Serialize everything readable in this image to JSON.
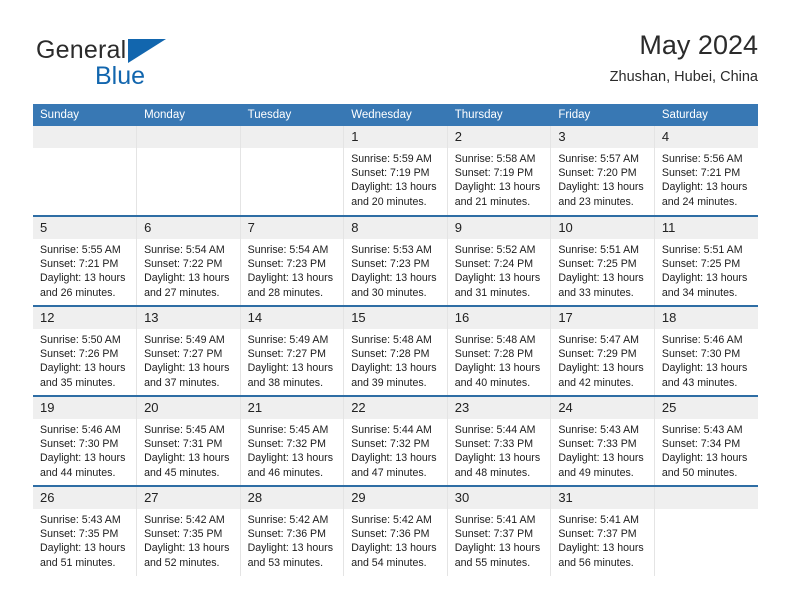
{
  "brand": {
    "name_part1": "General",
    "name_part2": "Blue",
    "logo_icon": "triangle-logo-icon"
  },
  "header": {
    "title": "May 2024",
    "location": "Zhushan, Hubei, China"
  },
  "calendar": {
    "accent_color": "#3878b4",
    "row_separator_color": "#2e6da4",
    "daynum_band_color": "#efefef",
    "weekday_headers": [
      "Sunday",
      "Monday",
      "Tuesday",
      "Wednesday",
      "Thursday",
      "Friday",
      "Saturday"
    ],
    "labels": {
      "sunrise": "Sunrise:",
      "sunset": "Sunset:",
      "daylight": "Daylight:"
    },
    "weeks": [
      [
        {
          "day": "",
          "blank": true
        },
        {
          "day": "",
          "blank": true
        },
        {
          "day": "",
          "blank": true
        },
        {
          "day": "1",
          "sunrise": "Sunrise: 5:59 AM",
          "sunset": "Sunset: 7:19 PM",
          "daylight_l1": "Daylight: 13 hours",
          "daylight_l2": "and 20 minutes."
        },
        {
          "day": "2",
          "sunrise": "Sunrise: 5:58 AM",
          "sunset": "Sunset: 7:19 PM",
          "daylight_l1": "Daylight: 13 hours",
          "daylight_l2": "and 21 minutes."
        },
        {
          "day": "3",
          "sunrise": "Sunrise: 5:57 AM",
          "sunset": "Sunset: 7:20 PM",
          "daylight_l1": "Daylight: 13 hours",
          "daylight_l2": "and 23 minutes."
        },
        {
          "day": "4",
          "sunrise": "Sunrise: 5:56 AM",
          "sunset": "Sunset: 7:21 PM",
          "daylight_l1": "Daylight: 13 hours",
          "daylight_l2": "and 24 minutes."
        }
      ],
      [
        {
          "day": "5",
          "sunrise": "Sunrise: 5:55 AM",
          "sunset": "Sunset: 7:21 PM",
          "daylight_l1": "Daylight: 13 hours",
          "daylight_l2": "and 26 minutes."
        },
        {
          "day": "6",
          "sunrise": "Sunrise: 5:54 AM",
          "sunset": "Sunset: 7:22 PM",
          "daylight_l1": "Daylight: 13 hours",
          "daylight_l2": "and 27 minutes."
        },
        {
          "day": "7",
          "sunrise": "Sunrise: 5:54 AM",
          "sunset": "Sunset: 7:23 PM",
          "daylight_l1": "Daylight: 13 hours",
          "daylight_l2": "and 28 minutes."
        },
        {
          "day": "8",
          "sunrise": "Sunrise: 5:53 AM",
          "sunset": "Sunset: 7:23 PM",
          "daylight_l1": "Daylight: 13 hours",
          "daylight_l2": "and 30 minutes."
        },
        {
          "day": "9",
          "sunrise": "Sunrise: 5:52 AM",
          "sunset": "Sunset: 7:24 PM",
          "daylight_l1": "Daylight: 13 hours",
          "daylight_l2": "and 31 minutes."
        },
        {
          "day": "10",
          "sunrise": "Sunrise: 5:51 AM",
          "sunset": "Sunset: 7:25 PM",
          "daylight_l1": "Daylight: 13 hours",
          "daylight_l2": "and 33 minutes."
        },
        {
          "day": "11",
          "sunrise": "Sunrise: 5:51 AM",
          "sunset": "Sunset: 7:25 PM",
          "daylight_l1": "Daylight: 13 hours",
          "daylight_l2": "and 34 minutes."
        }
      ],
      [
        {
          "day": "12",
          "sunrise": "Sunrise: 5:50 AM",
          "sunset": "Sunset: 7:26 PM",
          "daylight_l1": "Daylight: 13 hours",
          "daylight_l2": "and 35 minutes."
        },
        {
          "day": "13",
          "sunrise": "Sunrise: 5:49 AM",
          "sunset": "Sunset: 7:27 PM",
          "daylight_l1": "Daylight: 13 hours",
          "daylight_l2": "and 37 minutes."
        },
        {
          "day": "14",
          "sunrise": "Sunrise: 5:49 AM",
          "sunset": "Sunset: 7:27 PM",
          "daylight_l1": "Daylight: 13 hours",
          "daylight_l2": "and 38 minutes."
        },
        {
          "day": "15",
          "sunrise": "Sunrise: 5:48 AM",
          "sunset": "Sunset: 7:28 PM",
          "daylight_l1": "Daylight: 13 hours",
          "daylight_l2": "and 39 minutes."
        },
        {
          "day": "16",
          "sunrise": "Sunrise: 5:48 AM",
          "sunset": "Sunset: 7:28 PM",
          "daylight_l1": "Daylight: 13 hours",
          "daylight_l2": "and 40 minutes."
        },
        {
          "day": "17",
          "sunrise": "Sunrise: 5:47 AM",
          "sunset": "Sunset: 7:29 PM",
          "daylight_l1": "Daylight: 13 hours",
          "daylight_l2": "and 42 minutes."
        },
        {
          "day": "18",
          "sunrise": "Sunrise: 5:46 AM",
          "sunset": "Sunset: 7:30 PM",
          "daylight_l1": "Daylight: 13 hours",
          "daylight_l2": "and 43 minutes."
        }
      ],
      [
        {
          "day": "19",
          "sunrise": "Sunrise: 5:46 AM",
          "sunset": "Sunset: 7:30 PM",
          "daylight_l1": "Daylight: 13 hours",
          "daylight_l2": "and 44 minutes."
        },
        {
          "day": "20",
          "sunrise": "Sunrise: 5:45 AM",
          "sunset": "Sunset: 7:31 PM",
          "daylight_l1": "Daylight: 13 hours",
          "daylight_l2": "and 45 minutes."
        },
        {
          "day": "21",
          "sunrise": "Sunrise: 5:45 AM",
          "sunset": "Sunset: 7:32 PM",
          "daylight_l1": "Daylight: 13 hours",
          "daylight_l2": "and 46 minutes."
        },
        {
          "day": "22",
          "sunrise": "Sunrise: 5:44 AM",
          "sunset": "Sunset: 7:32 PM",
          "daylight_l1": "Daylight: 13 hours",
          "daylight_l2": "and 47 minutes."
        },
        {
          "day": "23",
          "sunrise": "Sunrise: 5:44 AM",
          "sunset": "Sunset: 7:33 PM",
          "daylight_l1": "Daylight: 13 hours",
          "daylight_l2": "and 48 minutes."
        },
        {
          "day": "24",
          "sunrise": "Sunrise: 5:43 AM",
          "sunset": "Sunset: 7:33 PM",
          "daylight_l1": "Daylight: 13 hours",
          "daylight_l2": "and 49 minutes."
        },
        {
          "day": "25",
          "sunrise": "Sunrise: 5:43 AM",
          "sunset": "Sunset: 7:34 PM",
          "daylight_l1": "Daylight: 13 hours",
          "daylight_l2": "and 50 minutes."
        }
      ],
      [
        {
          "day": "26",
          "sunrise": "Sunrise: 5:43 AM",
          "sunset": "Sunset: 7:35 PM",
          "daylight_l1": "Daylight: 13 hours",
          "daylight_l2": "and 51 minutes."
        },
        {
          "day": "27",
          "sunrise": "Sunrise: 5:42 AM",
          "sunset": "Sunset: 7:35 PM",
          "daylight_l1": "Daylight: 13 hours",
          "daylight_l2": "and 52 minutes."
        },
        {
          "day": "28",
          "sunrise": "Sunrise: 5:42 AM",
          "sunset": "Sunset: 7:36 PM",
          "daylight_l1": "Daylight: 13 hours",
          "daylight_l2": "and 53 minutes."
        },
        {
          "day": "29",
          "sunrise": "Sunrise: 5:42 AM",
          "sunset": "Sunset: 7:36 PM",
          "daylight_l1": "Daylight: 13 hours",
          "daylight_l2": "and 54 minutes."
        },
        {
          "day": "30",
          "sunrise": "Sunrise: 5:41 AM",
          "sunset": "Sunset: 7:37 PM",
          "daylight_l1": "Daylight: 13 hours",
          "daylight_l2": "and 55 minutes."
        },
        {
          "day": "31",
          "sunrise": "Sunrise: 5:41 AM",
          "sunset": "Sunset: 7:37 PM",
          "daylight_l1": "Daylight: 13 hours",
          "daylight_l2": "and 56 minutes."
        },
        {
          "day": "",
          "blank": true
        }
      ]
    ]
  }
}
